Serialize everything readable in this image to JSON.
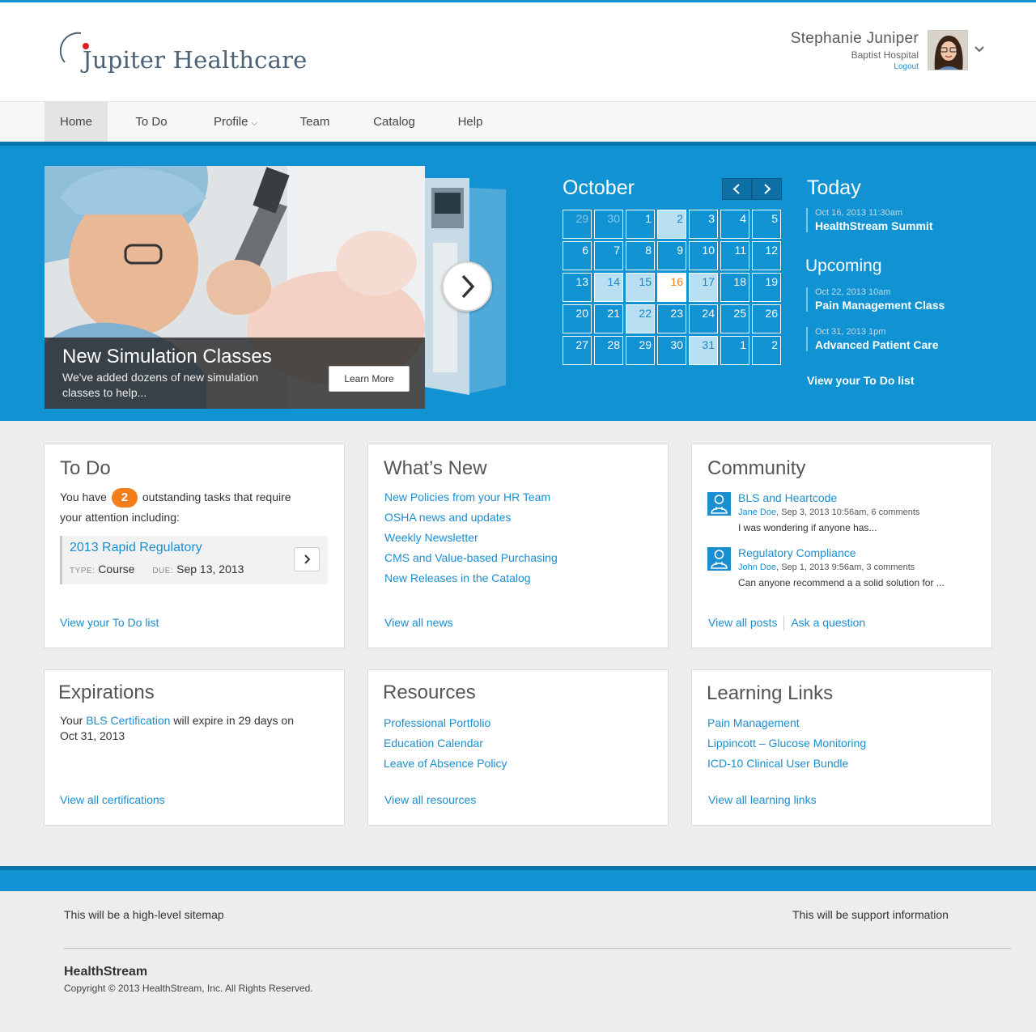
{
  "header": {
    "logo_text": "Jupiter Healthcare",
    "user_name": "Stephanie Juniper",
    "user_org": "Baptist Hospital",
    "logout_label": "Logout"
  },
  "nav": {
    "items": [
      {
        "label": "Home",
        "active": true
      },
      {
        "label": "To Do"
      },
      {
        "label": "Profile",
        "has_dropdown": true
      },
      {
        "label": "Team"
      },
      {
        "label": "Catalog"
      },
      {
        "label": "Help"
      }
    ]
  },
  "hero": {
    "slide_title": "New Simulation Classes",
    "slide_desc": "We've added dozens of new simulation classes to help...",
    "learn_more_label": "Learn More"
  },
  "calendar": {
    "month": "October",
    "weeks": [
      [
        {
          "d": "29",
          "s": "muted"
        },
        {
          "d": "30",
          "s": "muted"
        },
        {
          "d": "1"
        },
        {
          "d": "2",
          "s": "hl"
        },
        {
          "d": "3"
        },
        {
          "d": "4"
        },
        {
          "d": "5"
        }
      ],
      [
        {
          "d": "6"
        },
        {
          "d": "7"
        },
        {
          "d": "8"
        },
        {
          "d": "9"
        },
        {
          "d": "10"
        },
        {
          "d": "11"
        },
        {
          "d": "12"
        }
      ],
      [
        {
          "d": "13"
        },
        {
          "d": "14",
          "s": "hl"
        },
        {
          "d": "15",
          "s": "hl"
        },
        {
          "d": "16",
          "s": "today"
        },
        {
          "d": "17",
          "s": "hl"
        },
        {
          "d": "18"
        },
        {
          "d": "19"
        }
      ],
      [
        {
          "d": "20"
        },
        {
          "d": "21"
        },
        {
          "d": "22",
          "s": "hl"
        },
        {
          "d": "23"
        },
        {
          "d": "24"
        },
        {
          "d": "25"
        },
        {
          "d": "26"
        }
      ],
      [
        {
          "d": "27"
        },
        {
          "d": "28"
        },
        {
          "d": "29"
        },
        {
          "d": "30"
        },
        {
          "d": "31",
          "s": "hl"
        },
        {
          "d": "1"
        },
        {
          "d": "2"
        }
      ]
    ]
  },
  "events": {
    "today_heading": "Today",
    "today": {
      "date": "Oct 16, 2013 11:30am",
      "title": "HealthStream Summit"
    },
    "upcoming_heading": "Upcoming",
    "upcoming": [
      {
        "date": "Oct 22, 2013 10am",
        "title": "Pain Management Class"
      },
      {
        "date": "Oct 31, 2013 1pm",
        "title": "Advanced Patient Care"
      }
    ],
    "view_todo_label": "View your To Do list"
  },
  "todo": {
    "title": "To Do",
    "intro_before": "You have",
    "count": "2",
    "intro_after": "outstanding tasks that require",
    "intro_line2": "your attention including:",
    "task_title": "2013 Rapid Regulatory",
    "type_label": "TYPE:",
    "type_value": "Course",
    "due_label": "DUE:",
    "due_value": "Sep 13, 2013",
    "footer_link": "View your To Do list"
  },
  "whats_new": {
    "title": "What’s New",
    "links": [
      "New Policies from your HR Team",
      "OSHA news and updates",
      "Weekly Newsletter",
      "CMS and Value-based Purchasing",
      "New Releases in the Catalog"
    ],
    "footer_link": "View all news"
  },
  "community": {
    "title": "Community",
    "posts": [
      {
        "title": "BLS and Heartcode",
        "author": "Jane Doe",
        "meta": ", Sep 3, 2013 10:56am, 6 comments",
        "snippet": "I was wondering if anyone has..."
      },
      {
        "title": "Regulatory Compliance",
        "author": "John Doe",
        "meta": ", Sep 1, 2013 9:56am, 3 comments",
        "snippet": "Can anyone recommend a a solid solution for ..."
      }
    ],
    "footer_link": "View all posts",
    "ask_link": "Ask a question"
  },
  "expirations": {
    "title": "Expirations",
    "text_before": "Your",
    "cert_link": "BLS Certification",
    "text_after": "will expire in 29 days on",
    "date": "Oct 31, 2013",
    "footer_link": "View all certifications"
  },
  "resources": {
    "title": "Resources",
    "links": [
      "Professional Portfolio",
      "Education Calendar",
      "Leave of Absence Policy"
    ],
    "footer_link": "View all resources"
  },
  "learning_links": {
    "title": "Learning Links",
    "links": [
      "Pain Management",
      "Lippincott – Glucose Monitoring",
      "ICD-10 Clinical User Bundle"
    ],
    "footer_link": "View all learning links"
  },
  "footer": {
    "sitemap_text": "This will be a high-level sitemap",
    "support_text": "This will be support information",
    "brand": "HealthStream",
    "copyright": "Copyright © 2013 HealthStream, Inc. All Rights Reserved."
  },
  "colors": {
    "brand_blue": "#1192d2",
    "link_blue": "#1b8ecf",
    "accent_orange": "#f27f1b"
  }
}
